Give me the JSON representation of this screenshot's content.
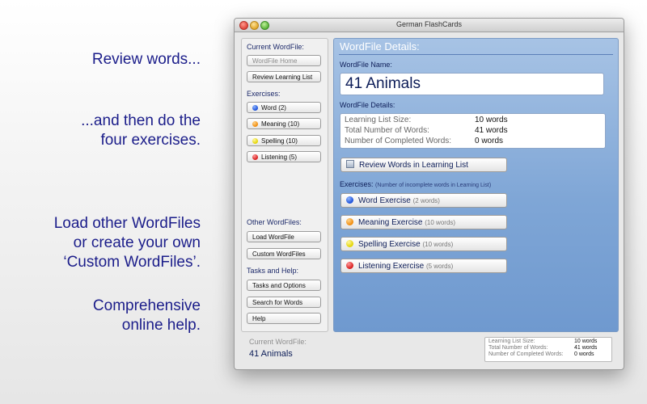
{
  "promo": {
    "line1": "Review words...",
    "line2a": "...and then do the",
    "line2b": "four exercises.",
    "line3a": "Load other WordFiles",
    "line3b": "or create your own",
    "line3c": "‘Custom WordFiles’.",
    "line4a": "Comprehensive",
    "line4b": "online help."
  },
  "window": {
    "title": "German FlashCards"
  },
  "sidebar": {
    "current_header": "Current WordFile:",
    "wordfile_home": "WordFile Home",
    "review_list": "Review Learning List",
    "exercises_header": "Exercises:",
    "ex_word": "Word (2)",
    "ex_meaning": "Meaning (10)",
    "ex_spelling": "Spelling (10)",
    "ex_listening": "Listening (5)",
    "other_header": "Other WordFiles:",
    "load_wordfile": "Load WordFile",
    "custom_wordfiles": "Custom WordFiles",
    "tasks_header": "Tasks and Help:",
    "tasks_options": "Tasks and Options",
    "search_words": "Search for Words",
    "help": "Help"
  },
  "main": {
    "title": "WordFile Details:",
    "name_label": "WordFile Name:",
    "name_value": "41 Animals",
    "details_label": "WordFile Details:",
    "learning_size_label": "Learning List Size:",
    "learning_size_value": "10 words",
    "total_words_label": "Total Number of Words:",
    "total_words_value": "41 words",
    "completed_label": "Number of Completed Words:",
    "completed_value": "0 words",
    "review_button": "Review Words in Learning List",
    "exercises_label": "Exercises:",
    "exercises_note": "(Number of incomplete words in Learning List)",
    "word_ex": "Word Exercise",
    "word_ex_count": "(2 words)",
    "meaning_ex": "Meaning Exercise",
    "meaning_ex_count": "(10 words)",
    "spelling_ex": "Spelling Exercise",
    "spelling_ex_count": "(10 words)",
    "listening_ex": "Listening Exercise",
    "listening_ex_count": "(5 words)"
  },
  "status": {
    "current_label": "Current WordFile:",
    "current_value": "41 Animals",
    "learning_size_label": "Learning List Size:",
    "learning_size_value": "10 words",
    "total_words_label": "Total Number of Words:",
    "total_words_value": "41 words",
    "completed_label": "Number of Completed Words:",
    "completed_value": "0 words"
  }
}
